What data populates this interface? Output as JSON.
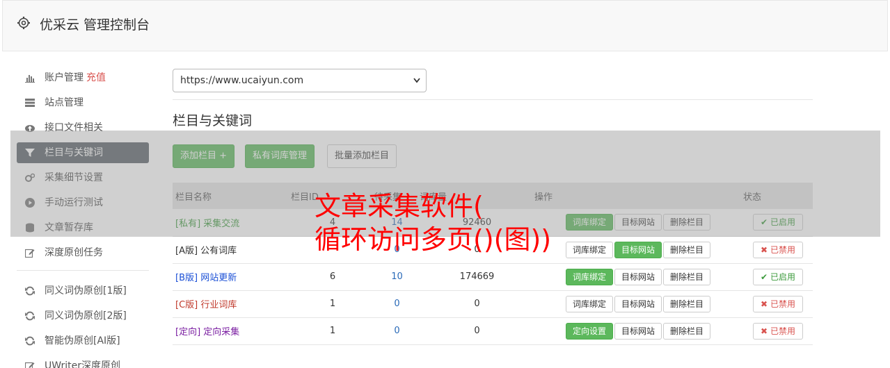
{
  "header": {
    "title": "优采云 管理控制台",
    "icon": "gear-icon"
  },
  "sidebar": {
    "items": [
      {
        "label": "账户管理",
        "badge": "充值",
        "icon": "bar-chart-icon"
      },
      {
        "label": "站点管理",
        "icon": "server-icon"
      },
      {
        "label": "接口文件相关",
        "icon": "cloud-upload-icon"
      },
      {
        "label": "栏目与关键词",
        "icon": "filter-icon",
        "active": true
      },
      {
        "label": "采集细节设置",
        "icon": "cogs-icon"
      },
      {
        "label": "手动运行测试",
        "icon": "play-circle-icon"
      },
      {
        "label": "文章暂存库",
        "icon": "database-icon"
      },
      {
        "label": "深度原创任务",
        "icon": "edit-icon"
      }
    ],
    "items2": [
      {
        "label": "同义词伪原创[1版]",
        "icon": "refresh-icon"
      },
      {
        "label": "同义词伪原创[2版]",
        "icon": "refresh-icon"
      },
      {
        "label": "智能伪原创[AI版]",
        "icon": "refresh-icon"
      },
      {
        "label": "UWriter深度原创",
        "icon": "edit-icon"
      }
    ]
  },
  "main": {
    "site_select": "https://www.ucaiyun.com",
    "section_title": "栏目与关键词",
    "buttons": {
      "add_column": "添加栏目 +",
      "private_lib": "私有词库管理",
      "batch_add": "批量添加栏目"
    },
    "table": {
      "headers": {
        "name": "栏目名称",
        "id": "栏目ID",
        "col3": "待采集",
        "col4": "词库量",
        "ops": "操作",
        "status": "状态"
      },
      "rows": [
        {
          "name": "[私有] 采集交流",
          "id": "4",
          "c3": "14",
          "c4": "92460",
          "op1": "词库绑定",
          "op2": "目标网站",
          "op3": "删除栏目",
          "status": "已启用",
          "color": "#3c9a3c"
        },
        {
          "name": "[A版] 公有词库",
          "id": "",
          "c3": "0",
          "c4": "0",
          "op1": "词库绑定",
          "op2": "目标网站",
          "op3": "删除栏目",
          "status": "已禁用",
          "color": "#333333"
        },
        {
          "name": "[B版] 网站更新",
          "id": "6",
          "c3": "10",
          "c4": "174669",
          "op1": "词库绑定",
          "op2": "目标网站",
          "op3": "删除栏目",
          "status": "已启用",
          "color": "#1a4fd6"
        },
        {
          "name": "[C版] 行业词库",
          "id": "1",
          "c3": "0",
          "c4": "0",
          "op1": "词库绑定",
          "op2": "目标网站",
          "op3": "删除栏目",
          "status": "已禁用",
          "color": "#c0392b"
        },
        {
          "name": "[定向] 定向采集",
          "id": "1",
          "c3": "0",
          "c4": "0",
          "op1": "定向设置",
          "op2": "目标网站",
          "op3": "删除栏目",
          "status": "已禁用",
          "color": "#7b1fa2"
        }
      ]
    }
  },
  "watermark": {
    "line1": "文章采集软件(",
    "line2": "循环访问多页()(图))"
  }
}
